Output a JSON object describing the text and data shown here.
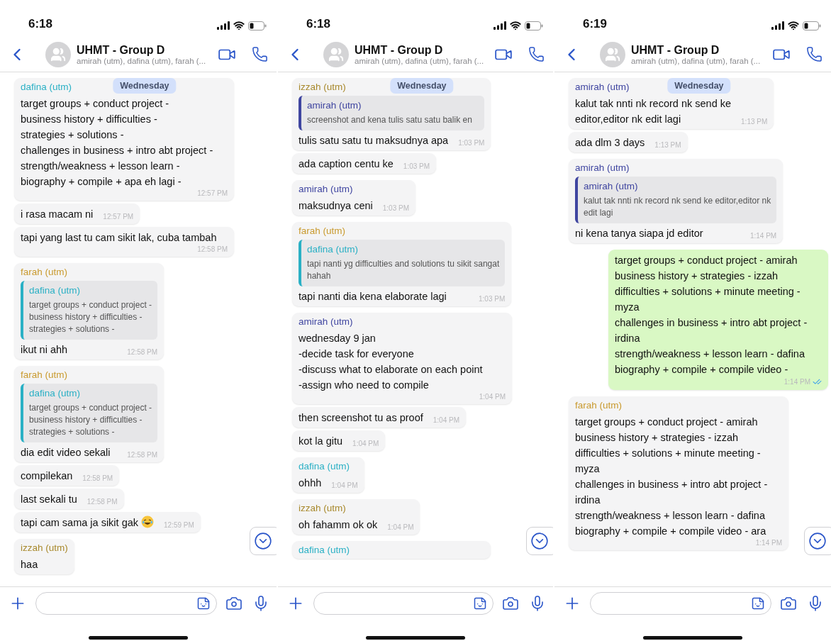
{
  "screens": [
    {
      "status_bar": {
        "time": "6:18"
      },
      "header": {
        "title": "UHMT - Group D",
        "subtitle": "amirah (utm), dafina (utm), farah (..."
      },
      "date_pill": "Wednesday",
      "chat": [
        {
          "sender": "dafina (utm)",
          "color": "#2ab0c5",
          "kind": "in",
          "bubbles": [
            {
              "text": "target groups + conduct project -\nbusiness history + difficulties -\nstrategies + solutions -\nchallenges in business + intro abt project -\nstrength/weakness + lesson learn -\nbiography + compile + apa eh lagi -",
              "time": "12:57 PM"
            },
            {
              "text": "i rasa macam ni",
              "time": "12:57 PM"
            },
            {
              "text": "tapi yang last tu cam sikit lak, cuba tambah",
              "time": "12:58 PM"
            }
          ]
        },
        {
          "sender": "farah (utm)",
          "color": "#c99a2e",
          "kind": "in",
          "bubbles": [
            {
              "quote": {
                "sender": "dafina (utm)",
                "color": "#2ab0c5",
                "text": "target groups + conduct project -\nbusiness history + difficulties -\nstrategies + solutions -"
              },
              "text": "ikut ni ahh",
              "time": "12:58 PM"
            }
          ]
        },
        {
          "sender": "farah (utm)",
          "color": "#c99a2e",
          "kind": "in",
          "bubbles": [
            {
              "quote": {
                "sender": "dafina (utm)",
                "color": "#2ab0c5",
                "text": "target groups + conduct project -\nbusiness history + difficulties -\nstrategies + solutions -"
              },
              "text": "dia edit video sekali",
              "time": "12:58 PM"
            },
            {
              "text": "compilekan",
              "time": "12:58 PM"
            },
            {
              "text": "last sekali tu",
              "time": "12:58 PM"
            },
            {
              "text": "tapi cam sama ja sikit gak",
              "kind": "emoji",
              "time": "12:59 PM"
            }
          ]
        },
        {
          "sender": "izzah (utm)",
          "color": "#a8892c",
          "kind": "in",
          "bubbles": [
            {
              "text": "haa"
            }
          ]
        }
      ]
    },
    {
      "status_bar": {
        "time": "6:18"
      },
      "header": {
        "title": "UHMT - Group D",
        "subtitle": "amirah (utm), dafina (utm), farah (..."
      },
      "date_pill": "Wednesday",
      "chat": [
        {
          "sender": "izzah (utm)",
          "color": "#a8892c",
          "kind": "in",
          "bubbles": [
            {
              "quote": {
                "sender": "amirah (utm)",
                "color": "#3f45a0",
                "text": "screenshot and kena tulis satu satu balik en"
              },
              "text": "tulis satu satu tu maksudnya apa",
              "time": "1:03 PM"
            },
            {
              "text": "ada caption centu ke",
              "time": "1:03 PM"
            }
          ]
        },
        {
          "sender": "amirah (utm)",
          "color": "#3f45a0",
          "kind": "in",
          "bubbles": [
            {
              "text": "maksudnya ceni",
              "time": "1:03 PM"
            }
          ]
        },
        {
          "sender": "farah (utm)",
          "color": "#c99a2e",
          "kind": "in",
          "bubbles": [
            {
              "quote": {
                "sender": "dafina (utm)",
                "color": "#2ab0c5",
                "text": "tapi nanti yg difficulties and solutions tu sikit sangat\nhahah"
              },
              "text": "tapi nanti dia kena elaborate lagi",
              "time": "1:03 PM"
            }
          ]
        },
        {
          "sender": "amirah (utm)",
          "color": "#3f45a0",
          "kind": "in",
          "bubbles": [
            {
              "text": "wednesday 9 jan\n-decide task for everyone\n-discuss what to elaborate on each point\n-assign who need to compile",
              "time": "1:04 PM"
            },
            {
              "text": "then screenshot tu as proof",
              "time": "1:04 PM"
            },
            {
              "text": "kot la gitu",
              "time": "1:04 PM"
            }
          ]
        },
        {
          "sender": "dafina (utm)",
          "color": "#2ab0c5",
          "kind": "in",
          "bubbles": [
            {
              "text": "ohhh",
              "time": "1:04 PM"
            }
          ]
        },
        {
          "sender": "izzah (utm)",
          "color": "#a8892c",
          "kind": "in",
          "bubbles": [
            {
              "text": "oh fahamm ok ok",
              "time": "1:04 PM"
            }
          ]
        },
        {
          "sender": "dafina (utm)",
          "color": "#2ab0c5",
          "kind": "in"
        }
      ]
    },
    {
      "status_bar": {
        "time": "6:19"
      },
      "header": {
        "title": "UHMT - Group D",
        "subtitle": "amirah (utm), dafina (utm), farah (..."
      },
      "date_pill": "Wednesday",
      "chat": [
        {
          "sender": "amirah (utm)",
          "color": "#3f45a0",
          "kind": "in",
          "bubbles": [
            {
              "text": "kalut tak nnti nk record nk send ke\neditor,editor nk edit lagi",
              "time": "1:13 PM"
            },
            {
              "text": "ada dlm 3 days",
              "time": "1:13 PM"
            }
          ]
        },
        {
          "sender": "amirah (utm)",
          "color": "#3f45a0",
          "kind": "in",
          "bubbles": [
            {
              "quote": {
                "sender": "amirah (utm)",
                "color": "#3f45a0",
                "text": "kalut tak nnti nk record nk send ke editor,editor nk\nedit lagi"
              },
              "text": "ni kena tanya siapa jd editor",
              "time": "1:14 PM"
            }
          ]
        },
        {
          "kind": "out",
          "bubbles": [
            {
              "text": "target groups + conduct project - amirah\nbusiness history + strategies - izzah\ndifficulties + solutions + minute meeting -\nmyza\nchallenges in business + intro abt project -\nirdina\nstrength/weakness + lesson learn - dafina\nbiography + compile + compile video -",
              "time": "1:14 PM",
              "read": true
            }
          ]
        },
        {
          "sender": "farah (utm)",
          "color": "#c99a2e",
          "kind": "in",
          "bubbles": [
            {
              "text": "target groups + conduct project - amirah\nbusiness history + strategies - izzah\ndifficulties + solutions + minute meeting -\nmyza\nchallenges in business + intro abt project -\nirdina\nstrength/weakness + lesson learn - dafina\nbiography + compile + compile video - ara",
              "time": "1:14 PM"
            }
          ]
        }
      ]
    }
  ]
}
